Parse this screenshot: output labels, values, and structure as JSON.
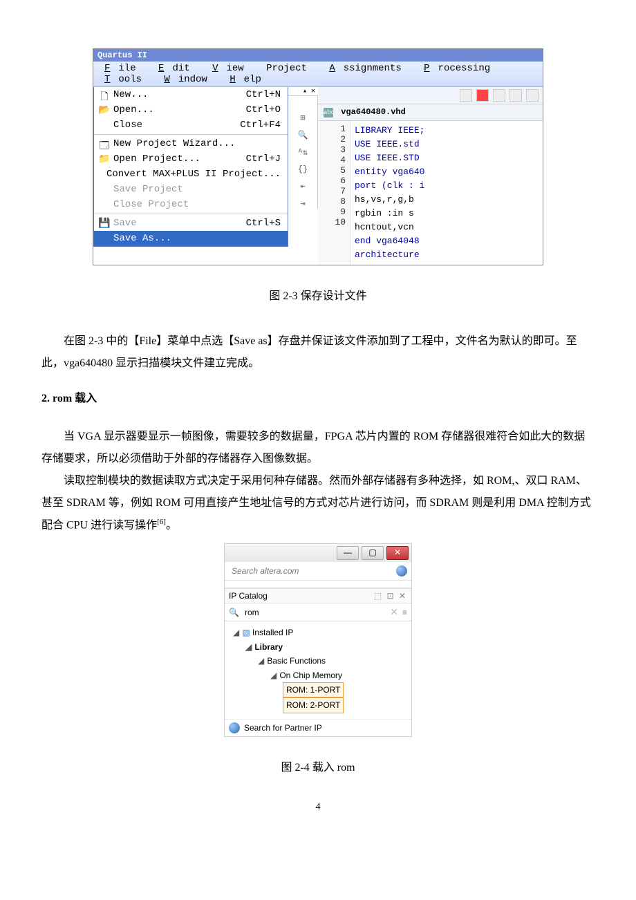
{
  "quartus": {
    "title": "Quartus II ",
    "menubar": [
      {
        "u": "F",
        "rest": "ile"
      },
      {
        "u": "E",
        "rest": "dit"
      },
      {
        "u": "V",
        "rest": "iew"
      },
      {
        "u": "",
        "rest": "Project"
      },
      {
        "u": "A",
        "rest": "ssignments"
      },
      {
        "u": "P",
        "rest": "rocessing"
      },
      {
        "u": "T",
        "rest": "ools"
      },
      {
        "u": "W",
        "rest": "indow"
      },
      {
        "u": "H",
        "rest": "elp"
      }
    ],
    "file_menu": {
      "group1": [
        {
          "label": "New...",
          "shortcut": "Ctrl+N",
          "icon": "🗋"
        },
        {
          "label": "Open...",
          "shortcut": "Ctrl+O",
          "icon": "📂"
        },
        {
          "label": "Close",
          "shortcut": "Ctrl+F4"
        }
      ],
      "group2": [
        {
          "label": "New Project Wizard...",
          "icon": "🗔"
        },
        {
          "label": "Open Project...",
          "shortcut": "Ctrl+J",
          "icon": "📁"
        },
        {
          "label": "Convert MAX+PLUS II Project..."
        },
        {
          "label": "Save Project",
          "disabled": true
        },
        {
          "label": "Close Project",
          "disabled": true
        }
      ],
      "group3": [
        {
          "label": "Save",
          "shortcut": "Ctrl+S",
          "icon": "💾",
          "disabled": true
        },
        {
          "label": "Save As...",
          "hover": true
        }
      ]
    },
    "right_tab": "vga640480.vhd",
    "code": [
      {
        "n": 1,
        "t": "LIBRARY IEEE;"
      },
      {
        "n": 2,
        "t": "USE IEEE.std"
      },
      {
        "n": 3,
        "t": "USE IEEE.STD"
      },
      {
        "n": 4,
        "t": "entity vga640"
      },
      {
        "n": 5,
        "t": "port (clk : i"
      },
      {
        "n": 6,
        "t": "    hs,vs,r,g,b"
      },
      {
        "n": 7,
        "t": "    rgbin :in s"
      },
      {
        "n": 8,
        "t": "    hcntout,vcn"
      },
      {
        "n": 9,
        "t": "end vga64048"
      },
      {
        "n": 10,
        "t": "architecture"
      }
    ]
  },
  "caption1": "图 2-3  保存设计文件",
  "para1": "在图 2-3 中的【File】菜单中点选【Save as】存盘并保证该文件添加到了工程中，文件名为默认的即可。至此，vga640480 显示扫描模块文件建立完成。",
  "section2": "2.   rom 载入",
  "para2a": "当 VGA 显示器要显示一帧图像，需要较多的数据量，FPGA 芯片内置的 ROM 存储器很难符合如此大的数据存储要求，所以必须借助于外部的存储器存入图像数据。",
  "para2b_a": "读取控制模块的数据读取方式决定于采用何种存储器。然而外部存储器有多种选择，如 ROM,、双口 RAM、甚至 SDRAM 等，例如 ROM 可用直接产生地址信号的方式对芯片进行访问，而 SDRAM 则是利用 DMA 控制方式配合 CPU 进行读写操作",
  "para2b_ref": "[6]",
  "para2b_b": "。",
  "ipcat": {
    "search_placeholder": "Search altera.com",
    "panel_title": "IP Catalog",
    "panel_ctrls": "▫ ✕",
    "filter_value": "rom",
    "tree": {
      "root": "Installed IP",
      "lib": "Library",
      "bf": "Basic Functions",
      "ocm": "On Chip Memory",
      "r1": "ROM: 1-PORT",
      "r2": "ROM: 2-PORT"
    },
    "footer": "Search for Partner IP"
  },
  "caption2": "图 2-4 载入 rom",
  "pagenum": "4"
}
